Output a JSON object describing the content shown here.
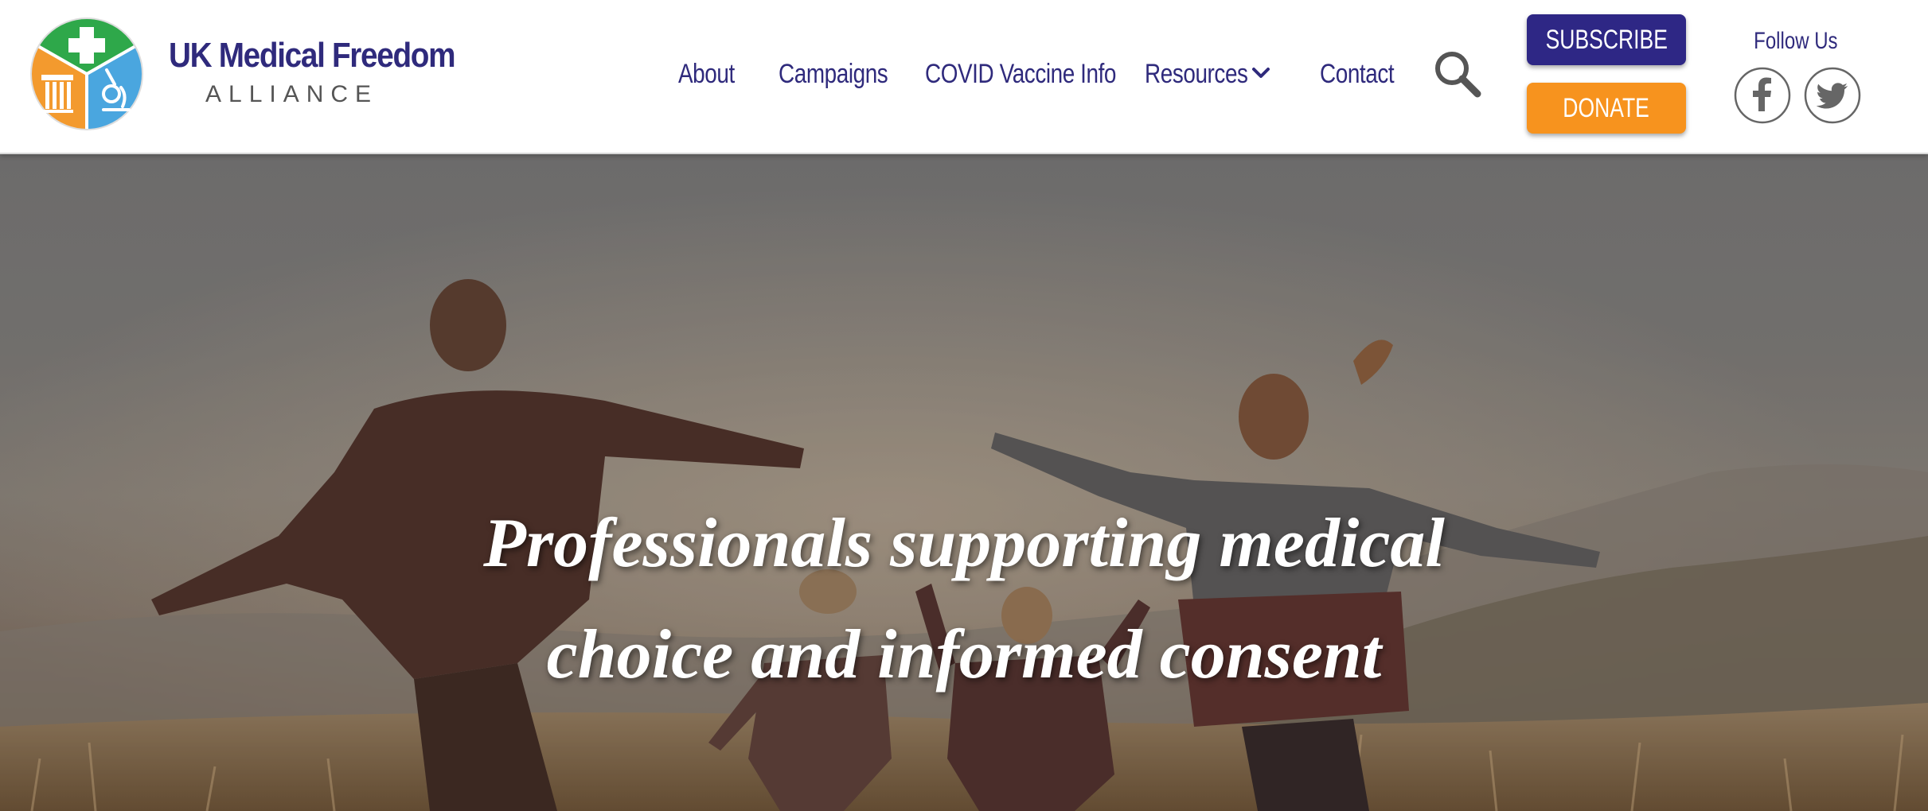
{
  "brand": {
    "name": "UK Medical Freedom",
    "subtitle": "ALLIANCE",
    "logo_icon": "medical-freedom-logo-icon"
  },
  "nav": {
    "items": [
      {
        "label": "About"
      },
      {
        "label": "Campaigns"
      },
      {
        "label": "COVID Vaccine Info"
      },
      {
        "label": "Resources",
        "has_dropdown": true
      },
      {
        "label": "Contact"
      }
    ],
    "search_icon": "search-icon",
    "dropdown_icon": "chevron-down-icon"
  },
  "buttons": {
    "subscribe_label": "SUBSCRIBE",
    "donate_label": "DONATE"
  },
  "social": {
    "label": "Follow Us",
    "icons": [
      "facebook-icon",
      "twitter-icon"
    ]
  },
  "hero": {
    "headline_line1": "Professionals supporting medical",
    "headline_line2": "choice and informed consent"
  },
  "colors": {
    "brand_purple": "#2f2a7c",
    "subscribe_bg": "#2e2785",
    "donate_bg": "#f7931e",
    "logo_green": "#2ea84a",
    "logo_orange": "#f39a2e",
    "logo_blue": "#3aa0dd"
  }
}
